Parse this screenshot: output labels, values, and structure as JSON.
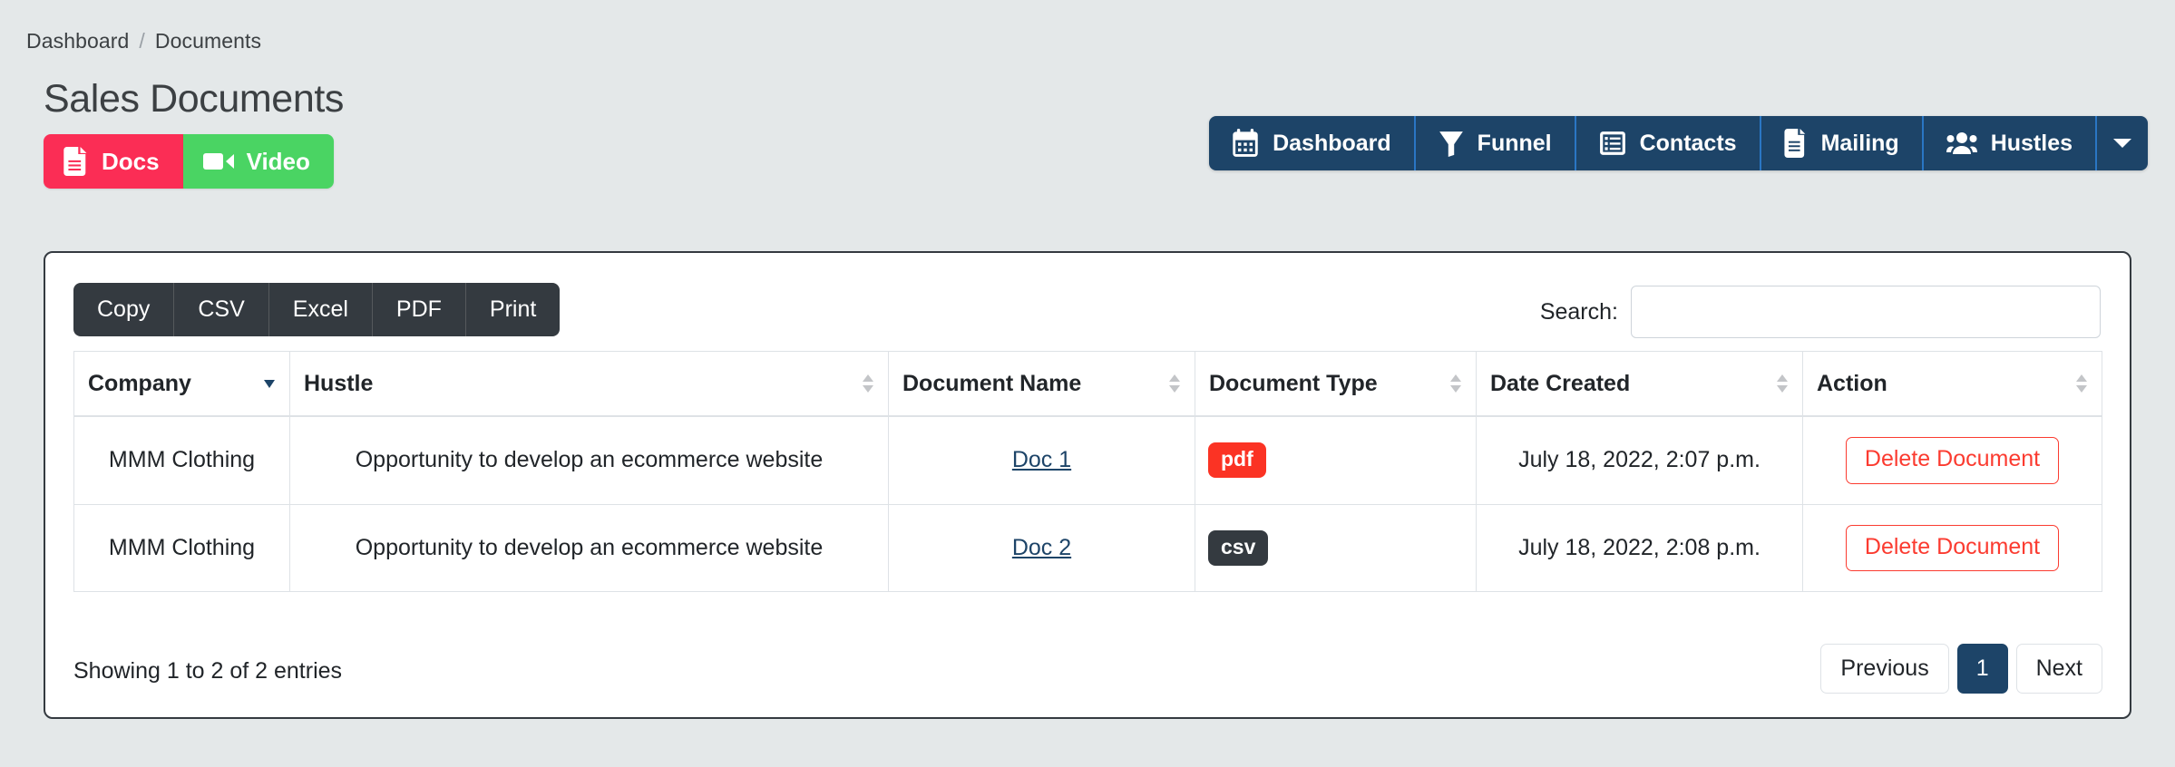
{
  "breadcrumb": {
    "parent": "Dashboard",
    "separator": "/",
    "current": "Documents"
  },
  "page_title": "Sales Documents",
  "view_toggle": {
    "docs": {
      "label": "Docs",
      "icon": "document-icon",
      "color": "#fb2d55"
    },
    "video": {
      "label": "Video",
      "icon": "video-camera-icon",
      "color": "#4ad463"
    }
  },
  "topnav": {
    "background": "#1d4468",
    "divider": "#2a76c4",
    "items": [
      {
        "label": "Dashboard",
        "icon": "calendar-icon"
      },
      {
        "label": "Funnel",
        "icon": "funnel-icon"
      },
      {
        "label": "Contacts",
        "icon": "list-box-icon"
      },
      {
        "label": "Mailing",
        "icon": "document-icon"
      },
      {
        "label": "Hustles",
        "icon": "users-icon"
      }
    ],
    "caret": {
      "icon": "chevron-down-icon"
    }
  },
  "table_tools": {
    "exports": [
      "Copy",
      "CSV",
      "Excel",
      "PDF",
      "Print"
    ],
    "search": {
      "label": "Search:",
      "value": "",
      "placeholder": ""
    }
  },
  "table": {
    "columns": [
      {
        "label": "Company",
        "sort": "desc"
      },
      {
        "label": "Hustle",
        "sort": "both"
      },
      {
        "label": "Document Name",
        "sort": "both"
      },
      {
        "label": "Document Type",
        "sort": "both"
      },
      {
        "label": "Date Created",
        "sort": "both"
      },
      {
        "label": "Action",
        "sort": "both"
      }
    ],
    "rows": [
      {
        "company": "MMM Clothing",
        "hustle": "Opportunity to develop an ecommerce website",
        "document_name": "Doc 1",
        "document_type": "pdf",
        "document_type_style": "pdf",
        "date_created": "July 18, 2022, 2:07 p.m.",
        "action_label": "Delete Document"
      },
      {
        "company": "MMM Clothing",
        "hustle": "Opportunity to develop an ecommerce website",
        "document_name": "Doc 2",
        "document_type": "csv",
        "document_type_style": "csv",
        "date_created": "July 18, 2022, 2:08 p.m.",
        "action_label": "Delete Document"
      }
    ]
  },
  "footer": {
    "info": "Showing 1 to 2 of 2 entries",
    "pagination": {
      "previous": "Previous",
      "pages": [
        "1"
      ],
      "current_page": "1",
      "next": "Next"
    }
  },
  "colors": {
    "page_background": "#e4e8e9",
    "navy": "#1d4468",
    "danger": "#fb3b30",
    "pdf_badge": "#fb3324",
    "csv_badge": "#343a40",
    "docs_pink": "#fb2d55",
    "video_green": "#4ad463",
    "dark": "#343a40"
  }
}
